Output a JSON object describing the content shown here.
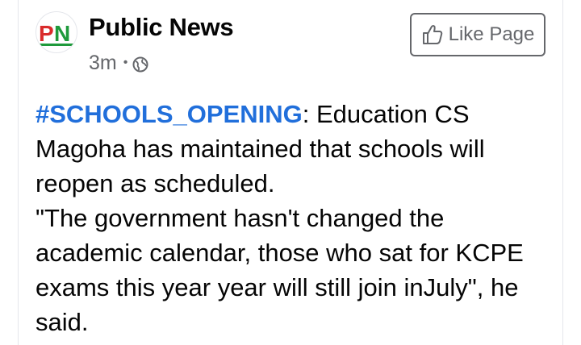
{
  "page": {
    "name": "Public News",
    "avatar_text": "PN",
    "timestamp": "3m",
    "separator": "•",
    "privacy_icon": "globe-icon"
  },
  "actions": {
    "like_label": "Like Page",
    "like_icon": "thumbs-up-icon"
  },
  "post": {
    "hashtag": "#SCHOOLS_OPENING",
    "lead_text": ": Education CS Magoha has maintained that schools will reopen as scheduled.",
    "quote_text": "\"The government hasn't changed the academic calendar, those who sat for KCPE exams this year year will still join inJuly\", he said."
  },
  "colors": {
    "hashtag": "#216fdb",
    "secondary_text": "#65676b",
    "logo_red": "#d92b2b",
    "logo_green": "#1e9a3b"
  }
}
